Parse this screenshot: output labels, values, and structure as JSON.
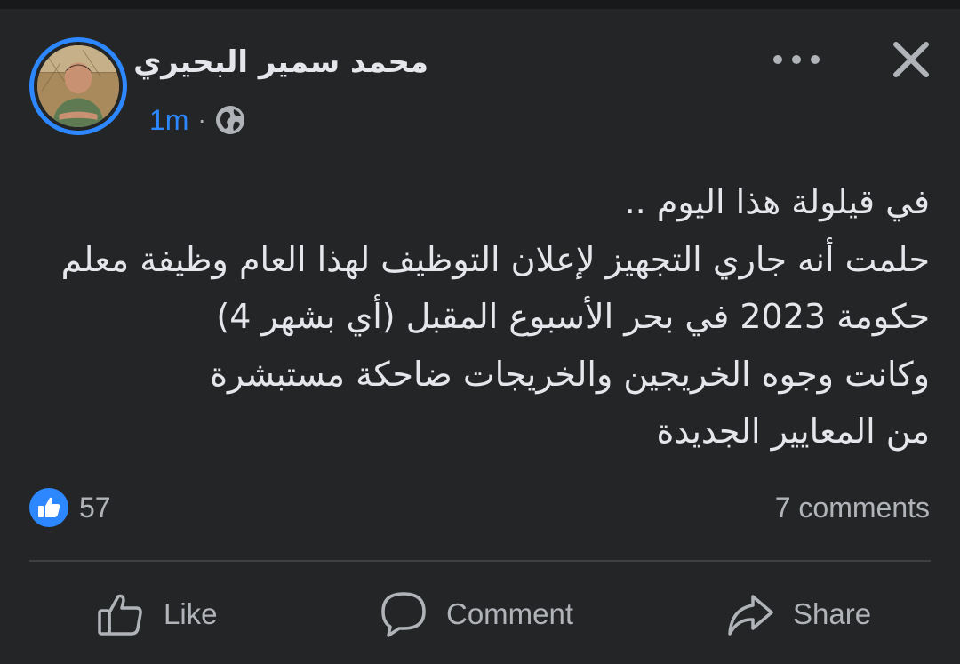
{
  "post": {
    "author_name": "محمد سمير البحيري",
    "timestamp": "1m",
    "separator": "·",
    "privacy_icon": "globe-icon",
    "body_lines": [
      "في قيلولة هذا اليوم ..",
      "حلمت أنه جاري التجهيز  لإعلان التوظيف لهذا العام وظيفة معلم",
      "حكومة 2023   في بحر الأسبوع المقبل (أي بشهر 4)",
      "وكانت وجوه الخريجين والخريجات ضاحكة مستبشرة",
      "من المعايير الجديدة"
    ]
  },
  "header_actions": {
    "more_icon": "more-horizontal-icon",
    "close_icon": "close-icon"
  },
  "stats": {
    "reaction_icon": "like-reaction-icon",
    "like_count": "57",
    "comments": "7 comments"
  },
  "actions": {
    "like_label": "Like",
    "comment_label": "Comment",
    "share_label": "Share"
  },
  "colors": {
    "background": "#242526",
    "accent_blue": "#2d88ff",
    "primary_text": "#e4e6eb",
    "secondary_text": "#b0b3b8",
    "divider": "#3e4042"
  }
}
